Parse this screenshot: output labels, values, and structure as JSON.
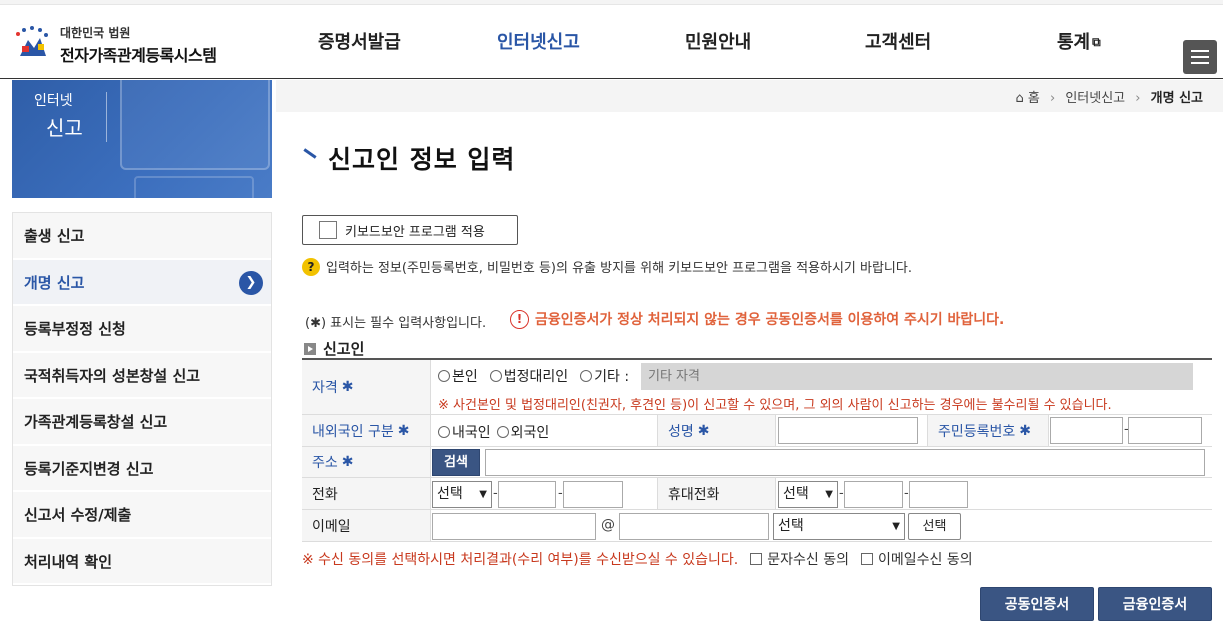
{
  "header": {
    "logo_sub": "대한민국 법원",
    "logo_main": "전자가족관계등록시스템",
    "nav": [
      {
        "label": "증명서발급"
      },
      {
        "label": "인터넷신고"
      },
      {
        "label": "민원안내"
      },
      {
        "label": "고객센터"
      },
      {
        "label": "통계"
      }
    ],
    "menu_icon": "hamburger-icon",
    "external_icon": "external-link-icon"
  },
  "banner": {
    "line1": "인터넷",
    "line2": "신고"
  },
  "sidebar": {
    "items": [
      {
        "label": "출생 신고"
      },
      {
        "label": "개명 신고"
      },
      {
        "label": "등록부정정 신청"
      },
      {
        "label": "국적취득자의 성본창설 신고"
      },
      {
        "label": "가족관계등록창설 신고"
      },
      {
        "label": "등록기준지변경 신고"
      },
      {
        "label": "신고서 수정/제출"
      },
      {
        "label": "처리내역 확인"
      }
    ],
    "active_index": 1
  },
  "breadcrumb": {
    "home": "홈",
    "section": "인터넷신고",
    "current": "개명 신고"
  },
  "page": {
    "title": "신고인 정보 입력",
    "keyboard_button": "키보드보안 프로그램 적용",
    "keyboard_note": "입력하는 정보(주민등록번호, 비밀번호 등)의 유출 방지를 위해 키보드보안 프로그램을 적용하시기 바랍니다.",
    "required_note": "(✱) 표시는 필수 입력사항입니다.",
    "warning": "금융인증서가 정상 처리되지 않는 경우 공동인증서를 이용하여 주시기 바랍니다.",
    "section": "신고인"
  },
  "form": {
    "qualification": {
      "label": "자격",
      "star": "✱",
      "options": [
        "본인",
        "법정대리인",
        "기타 :"
      ],
      "other_placeholder": "기타 자격",
      "note": "※ 사건본인 및 법정대리인(친권자, 후견인 등)이 신고할 수 있으며, 그 외의 사람이 신고하는 경우에는 불수리될 수 있습니다."
    },
    "nationality": {
      "label": "내외국인 구분",
      "star": "✱",
      "options": [
        "내국인",
        "외국인"
      ]
    },
    "name": {
      "label": "성명",
      "star": "✱",
      "value": ""
    },
    "rrn": {
      "label": "주민등록번호",
      "star": "✱",
      "sep": "-"
    },
    "address": {
      "label": "주소",
      "star": "✱",
      "search_button": "검색",
      "value": ""
    },
    "phone": {
      "label": "전화",
      "select": "선택",
      "sep": "-"
    },
    "mobile": {
      "label": "휴대전화",
      "select": "선택",
      "sep": "-"
    },
    "email": {
      "label": "이메일",
      "at": "@",
      "domain_select": "선택",
      "button": "선택"
    }
  },
  "consent": {
    "note": "※ 수신 동의를 선택하시면 처리결과(수리 여부)를 수신받으실 수 있습니다.",
    "sms": "문자수신 동의",
    "email": "이메일수신 동의"
  },
  "buttons": {
    "joint_cert": "공동인증서",
    "financial_cert": "금융인증서"
  },
  "colors": {
    "accent": "#2a56a6",
    "button": "#3a5583",
    "warning": "#e0623b"
  }
}
